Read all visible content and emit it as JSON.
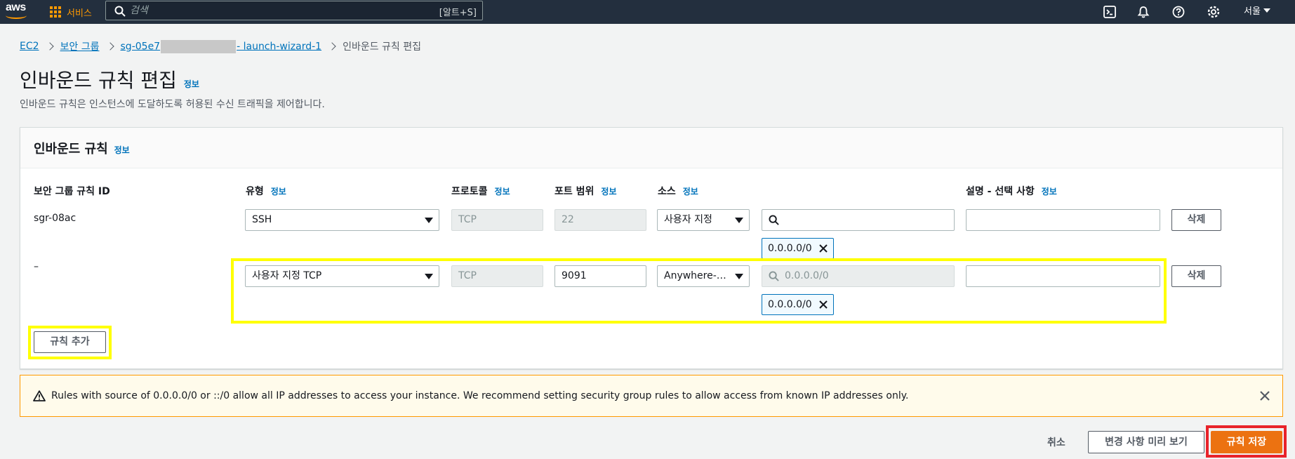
{
  "nav": {
    "logo_text": "aws",
    "services_label": "서비스",
    "search_placeholder": "검색",
    "search_shortcut": "[알트+S]",
    "region_label": "서울",
    "icons": [
      "cloudshell-icon",
      "bell-icon",
      "help-icon",
      "gear-icon"
    ]
  },
  "breadcrumb": {
    "items": [
      "EC2",
      "보안 그룹"
    ],
    "sg_prefix": "sg-05e7",
    "sg_suffix": "- launch-wizard-1",
    "current": "인바운드 규칙 편집"
  },
  "page": {
    "title": "인바운드 규칙 편집",
    "info": "정보",
    "description": "인바운드 규칙은 인스턴스에 도달하도록 허용된 수신 트래픽을 제어합니다."
  },
  "panel": {
    "title": "인바운드 규칙",
    "info": "정보",
    "columns": {
      "rule_id": "보안 그룹 규칙 ID",
      "type": "유형",
      "protocol": "프로토콜",
      "port_range": "포트 범위",
      "source": "소스",
      "description": "설명 - 선택 사항",
      "info": "정보"
    },
    "rows": [
      {
        "rule_id": "sgr-08ac",
        "type": "SSH",
        "protocol": "TCP",
        "port_range": "22",
        "source_type": "사용자 지정",
        "source_search": "",
        "cidr": "0.0.0.0/0",
        "description": "",
        "delete_label": "삭제"
      },
      {
        "rule_id": "–",
        "type": "사용자 지정 TCP",
        "protocol": "TCP",
        "port_range": "9091",
        "source_type": "Anywhere-I...",
        "source_search": "0.0.0.0/0",
        "cidr": "0.0.0.0/0",
        "description": "",
        "delete_label": "삭제"
      }
    ],
    "add_rule_label": "규칙 추가"
  },
  "warning": {
    "text": "Rules with source of 0.0.0.0/0 or ::/0 allow all IP addresses to access your instance. We recommend setting security group rules to allow access from known IP addresses only."
  },
  "footer": {
    "cancel_label": "취소",
    "preview_label": "변경 사항 미리 보기",
    "save_label": "규칙 저장"
  },
  "colors": {
    "nav_bg": "#232f3e",
    "accent_orange": "#ec7211",
    "link_blue": "#0073bb",
    "highlight_yellow": "#ffff00",
    "highlight_red": "#e8232a"
  }
}
